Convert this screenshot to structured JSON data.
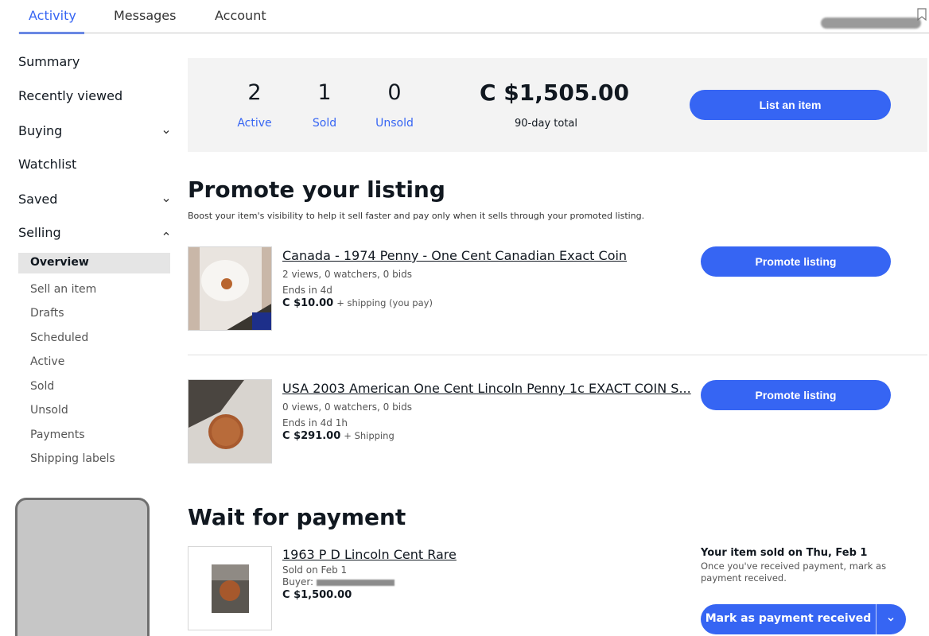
{
  "topnav": {
    "tabs": [
      {
        "label": "Activity",
        "active": true
      },
      {
        "label": "Messages",
        "active": false
      },
      {
        "label": "Account",
        "active": false
      }
    ],
    "accent": "#3665f3"
  },
  "sidebar": {
    "items": [
      {
        "label": "Summary"
      },
      {
        "label": "Recently viewed"
      },
      {
        "label": "Buying",
        "chevron": "chevron-down-icon"
      },
      {
        "label": "Watchlist"
      },
      {
        "label": "Saved",
        "chevron": "chevron-down-icon"
      },
      {
        "label": "Selling",
        "chevron": "chevron-up-icon"
      }
    ],
    "selling_sub": [
      {
        "label": "Overview",
        "active": true
      },
      {
        "label": "Sell an item"
      },
      {
        "label": "Drafts"
      },
      {
        "label": "Scheduled"
      },
      {
        "label": "Active"
      },
      {
        "label": "Sold"
      },
      {
        "label": "Unsold"
      },
      {
        "label": "Payments"
      },
      {
        "label": "Shipping labels"
      }
    ]
  },
  "summary": {
    "stats": [
      {
        "value": "2",
        "label": "Active"
      },
      {
        "value": "1",
        "label": "Sold"
      },
      {
        "value": "0",
        "label": "Unsold"
      }
    ],
    "total": "C $1,505.00",
    "total_label": "90-day total",
    "list_button": "List an item"
  },
  "promote": {
    "heading": "Promote your listing",
    "subtext": "Boost your item's visibility to help it sell faster and pay only when it sells through your promoted listing.",
    "listings": [
      {
        "title": "Canada - 1974 Penny - One Cent Canadian Exact Coin",
        "stats": "2 views, 0 watchers, 0 bids",
        "ends": "Ends in 4d",
        "price": "C $10.00",
        "shipping": "+ shipping (you pay)",
        "button": "Promote listing"
      },
      {
        "title": "USA 2003 American One Cent Lincoln Penny 1c EXACT COIN S...",
        "stats": "0 views, 0 watchers, 0 bids",
        "ends": "Ends in 4d 1h",
        "price": "C $291.00",
        "shipping": "+ Shipping",
        "button": "Promote listing"
      }
    ]
  },
  "payment": {
    "heading": "Wait for payment",
    "item": {
      "title": "1963 P D Lincoln Cent Rare",
      "sold_on": "Sold on Feb 1",
      "buyer_label": "Buyer:",
      "price": "C $1,500.00"
    },
    "status_head": "Your item sold on Thu, Feb 1",
    "status_note": "Once you've received payment, mark as payment received.",
    "button": "Mark as payment received"
  }
}
